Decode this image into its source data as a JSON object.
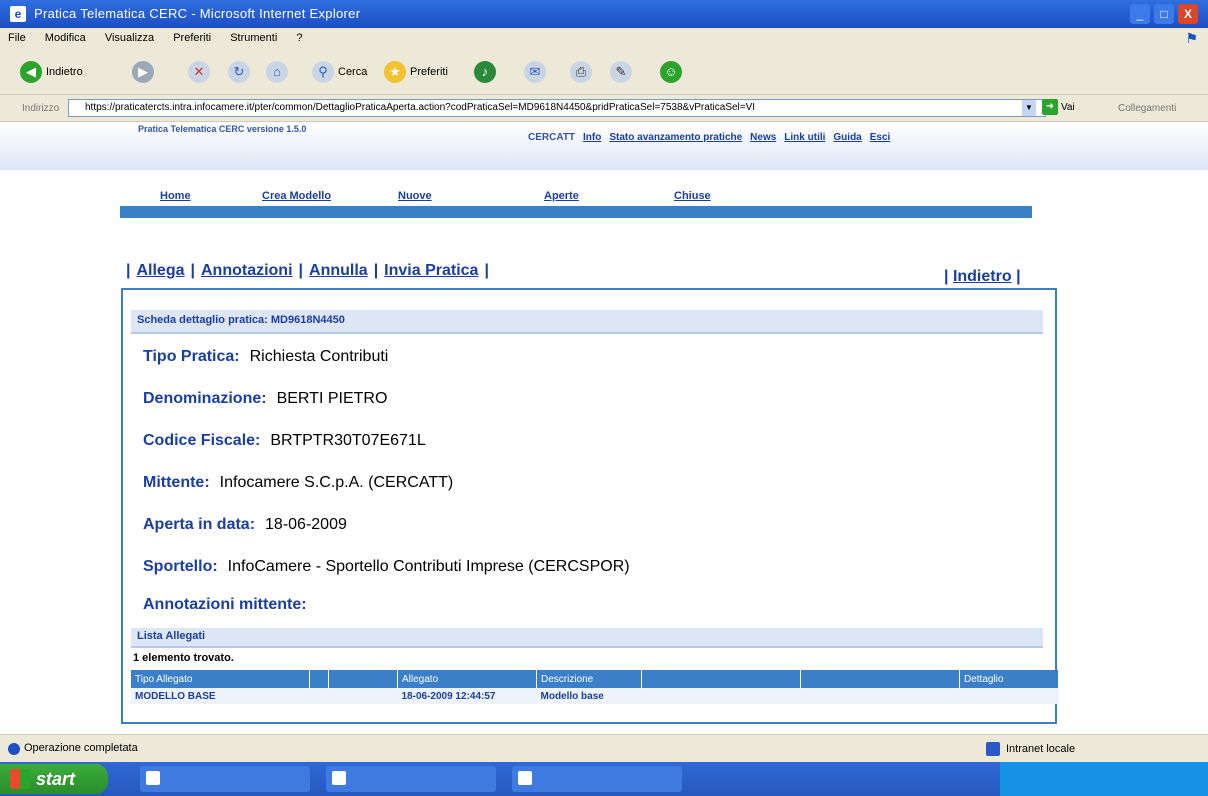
{
  "window": {
    "title": "Pratica Telematica CERC - Microsoft Internet Explorer",
    "controls": {
      "minimize": "_",
      "maximize": "□",
      "close": "X"
    }
  },
  "menu": [
    "File",
    "Modifica",
    "Visualizza",
    "Preferiti",
    "Strumenti",
    "?"
  ],
  "toolbar": {
    "back": "Indietro",
    "search": "Cerca",
    "favorites": "Preferiti"
  },
  "address": {
    "label": "Indirizzo",
    "url": "https://praticatercts.intra.infocamere.it/pter/common/DettaglioPraticaAperta.action?codPraticaSel=MD9618N4450&pridPraticaSel=7538&vPraticaSel=VI",
    "go": "Vai",
    "links": "Collegamenti"
  },
  "app": {
    "version": "Pratica Telematica CERC versione 1.5.0",
    "header_links": [
      "CERCATT",
      "Info",
      "Stato avanzamento pratiche",
      "News",
      "Link utili",
      "Guida",
      "Esci"
    ],
    "nav": [
      "Home",
      "Crea Modello",
      "Nuove",
      "Aperte",
      "Chiuse"
    ]
  },
  "actions": {
    "allega": "Allega",
    "annotazioni": "Annotazioni",
    "annulla": "Annulla",
    "invia": "Invia Pratica",
    "indietro": "Indietro"
  },
  "detail": {
    "title": "Scheda dettaglio pratica: MD9618N4450",
    "fields": [
      {
        "label": "Tipo Pratica:",
        "value": "Richiesta Contributi"
      },
      {
        "label": "Denominazione:",
        "value": "BERTI PIETRO"
      },
      {
        "label": "Codice Fiscale:",
        "value": "BRTPTR30T07E671L"
      },
      {
        "label": "Mittente:",
        "value": "Infocamere S.C.p.A. (CERCATT)"
      },
      {
        "label": "Aperta in data:",
        "value": "18-06-2009"
      },
      {
        "label": "Sportello:",
        "value": "InfoCamere - Sportello Contributi Imprese (CERCSPOR)"
      },
      {
        "label": "Annotazioni mittente:",
        "value": ""
      }
    ]
  },
  "attachments": {
    "title": "Lista Allegati",
    "count": "1 elemento trovato.",
    "columns": [
      "Tipo Allegato",
      "",
      "",
      "Allegato",
      "Descrizione",
      "",
      "",
      "Dettaglio"
    ],
    "rows": [
      [
        "MODELLO BASE",
        "",
        "",
        "18-06-2009 12:44:57",
        "Modello base",
        "",
        "",
        ""
      ]
    ]
  },
  "status": {
    "text": "Operazione completata",
    "zone": "Intranet locale"
  },
  "taskbar": {
    "start": "start"
  }
}
